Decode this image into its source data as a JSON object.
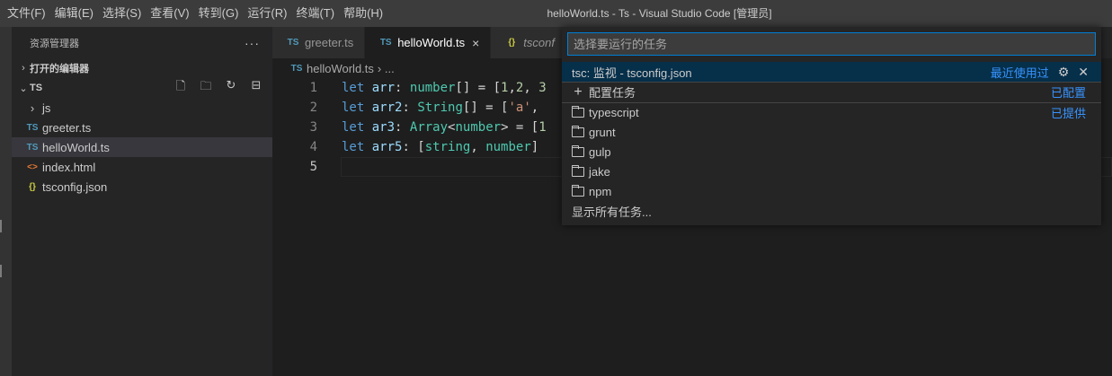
{
  "menu": [
    "文件(F)",
    "编辑(E)",
    "选择(S)",
    "查看(V)",
    "转到(G)",
    "运行(R)",
    "终端(T)",
    "帮助(H)"
  ],
  "window_title": "helloWorld.ts - Ts - Visual Studio Code [管理员]",
  "sidebar": {
    "title": "资源管理器",
    "more": "···",
    "open_editors": "打开的编辑器",
    "folder": "TS",
    "items": [
      {
        "icon": "›",
        "label": "js"
      },
      {
        "icon": "TS",
        "label": "greeter.ts"
      },
      {
        "icon": "TS",
        "label": "helloWorld.ts"
      },
      {
        "icon": "<>",
        "label": "index.html"
      },
      {
        "icon": "{}",
        "label": "tsconfig.json"
      }
    ]
  },
  "tabs": [
    {
      "icon": "TS",
      "label": "greeter.ts"
    },
    {
      "icon": "TS",
      "label": "helloWorld.ts",
      "close": "×"
    },
    {
      "icon": "{}",
      "label": "tsconf"
    }
  ],
  "breadcrumb": {
    "icon": "TS",
    "file": "helloWorld.ts",
    "rest": "› ..."
  },
  "editor": {
    "line_numbers": [
      "1",
      "2",
      "3",
      "4",
      "5"
    ],
    "lines": [
      "let arr: number[] = [1,2, 3",
      "let arr2: String[] = ['a', ",
      "let ar3: Array<number> = [1",
      "let arr5: [string, number] ",
      ""
    ]
  },
  "quickpick": {
    "placeholder": "选择要运行的任务",
    "items": [
      {
        "label": "tsc: 监视 - tsconfig.json",
        "right": "最近使用过"
      },
      {
        "label": "配置任务",
        "right": "已配置"
      },
      {
        "label": "typescript",
        "right": "已提供"
      },
      {
        "label": "grunt",
        "right": ""
      },
      {
        "label": "gulp",
        "right": ""
      },
      {
        "label": "jake",
        "right": ""
      },
      {
        "label": "npm",
        "right": ""
      },
      {
        "label": "显示所有任务...",
        "right": ""
      }
    ]
  }
}
